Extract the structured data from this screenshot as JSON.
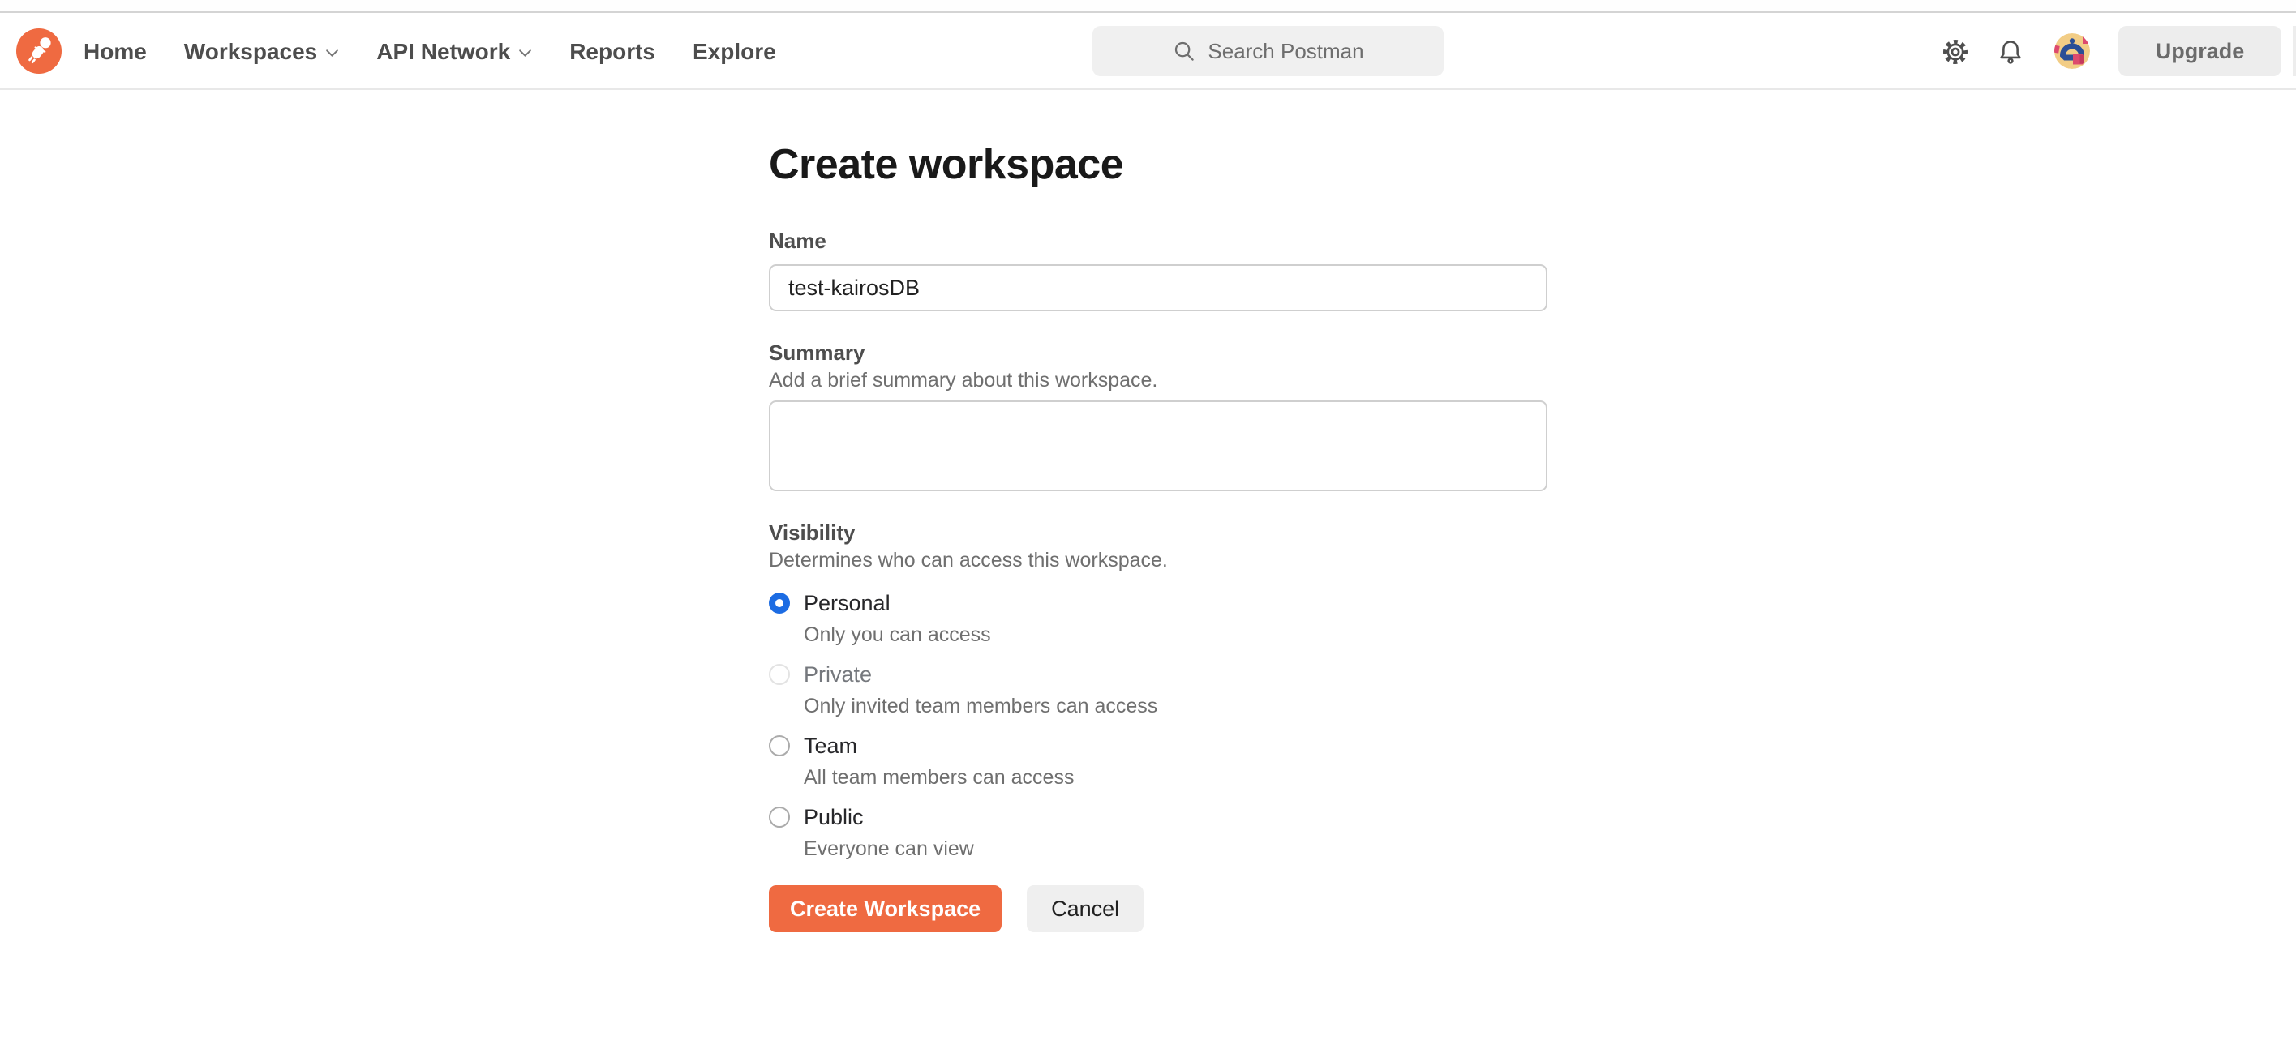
{
  "header": {
    "nav": [
      {
        "label": "Home"
      },
      {
        "label": "Workspaces"
      },
      {
        "label": "API Network"
      },
      {
        "label": "Reports"
      },
      {
        "label": "Explore"
      }
    ],
    "search": {
      "placeholder": "Search Postman"
    },
    "upgrade_label": "Upgrade",
    "icons": [
      "settings-gear",
      "notifications-bell",
      "user-avatar"
    ]
  },
  "form": {
    "title": "Create workspace",
    "name": {
      "label": "Name",
      "value": "test-kairosDB"
    },
    "summary": {
      "label": "Summary",
      "help": "Add a brief summary about this workspace.",
      "value": ""
    },
    "visibility": {
      "label": "Visibility",
      "help": "Determines who can access this workspace.",
      "options": [
        {
          "label": "Personal",
          "help": "Only you can access",
          "selected": true,
          "disabled": false
        },
        {
          "label": "Private",
          "help": "Only invited team members can access",
          "selected": false,
          "disabled": true
        },
        {
          "label": "Team",
          "help": "All team members can access",
          "selected": false,
          "disabled": false
        },
        {
          "label": "Public",
          "help": "Everyone can view",
          "selected": false,
          "disabled": false
        }
      ]
    },
    "actions": {
      "submit_label": "Create Workspace",
      "cancel_label": "Cancel"
    }
  },
  "colors": {
    "brand_orange": "#EF6A41",
    "radio_blue": "#1C6CE3",
    "header_border": "#e8e8e8"
  }
}
